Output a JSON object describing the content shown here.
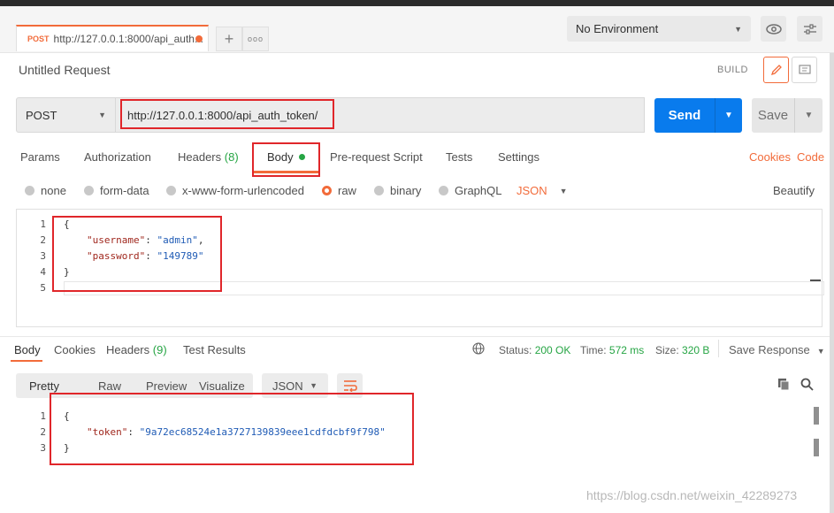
{
  "tab": {
    "method": "POST",
    "url": "http://127.0.0.1:8000/api_auth...",
    "plus": "+",
    "more": "ooo"
  },
  "environment": {
    "selected": "No Environment"
  },
  "request": {
    "title": "Untitled Request",
    "build_label": "BUILD",
    "method": "POST",
    "url": "http://127.0.0.1:8000/api_auth_token/",
    "send_label": "Send",
    "save_label": "Save"
  },
  "request_tabs": {
    "params": "Params",
    "authorization": "Authorization",
    "headers": "Headers",
    "headers_count": "(8)",
    "body": "Body",
    "pre_request": "Pre-request Script",
    "tests": "Tests",
    "settings": "Settings",
    "cookies": "Cookies",
    "code": "Code"
  },
  "body_types": {
    "none": "none",
    "form_data": "form-data",
    "urlencoded": "x-www-form-urlencoded",
    "raw": "raw",
    "binary": "binary",
    "graphql": "GraphQL",
    "format": "JSON",
    "beautify": "Beautify"
  },
  "request_body": {
    "line_numbers": [
      "1",
      "2",
      "3",
      "4",
      "5"
    ],
    "open": "{",
    "username_key": "\"username\"",
    "username_value": "\"admin\"",
    "password_key": "\"password\"",
    "password_value": "\"149789\"",
    "close": "}",
    "colon": ": ",
    "comma": ","
  },
  "response_tabs": {
    "body": "Body",
    "cookies": "Cookies",
    "headers": "Headers",
    "headers_count": "(9)",
    "test_results": "Test Results"
  },
  "response_status": {
    "status_label": "Status:",
    "status_value": "200 OK",
    "time_label": "Time:",
    "time_value": "572 ms",
    "size_label": "Size:",
    "size_value": "320 B",
    "save_response": "Save Response"
  },
  "response_views": {
    "pretty": "Pretty",
    "raw": "Raw",
    "preview": "Preview",
    "visualize": "Visualize",
    "format": "JSON"
  },
  "response_body": {
    "line_numbers": [
      "1",
      "2",
      "3"
    ],
    "open": "{",
    "token_key": "\"token\"",
    "token_value": "\"9a72ec68524e1a3727139839eee1cdfdcbf9f798\"",
    "close": "}",
    "colon": ": "
  },
  "watermark": "https://blog.csdn.net/weixin_42289273",
  "colors": {
    "accent": "#f26b3a",
    "send": "#097bed",
    "status_ok": "#26a544",
    "highlight": "#e0262a"
  }
}
